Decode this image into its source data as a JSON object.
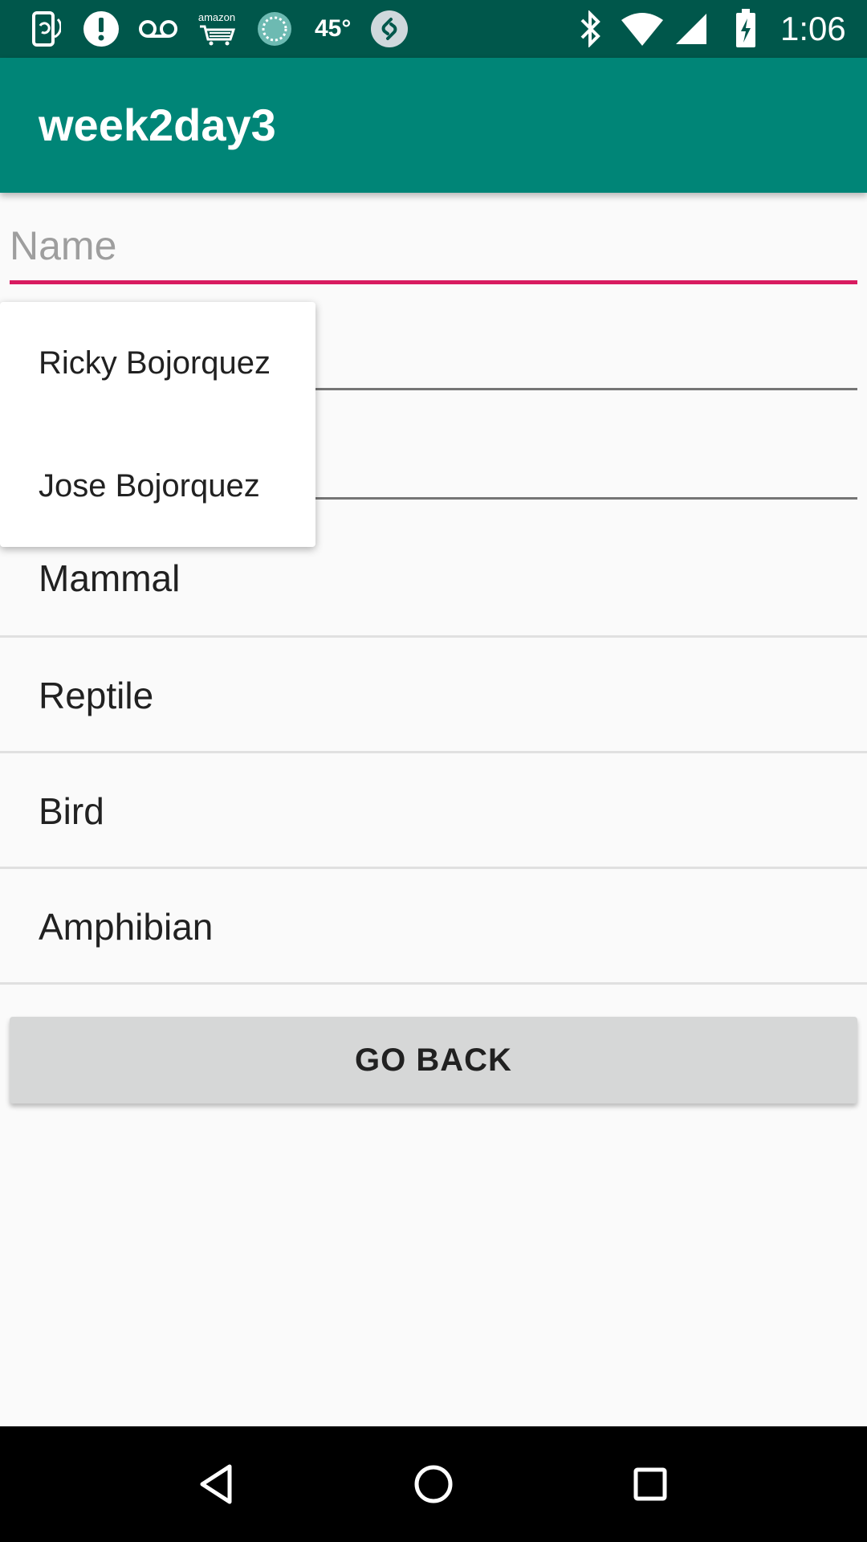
{
  "status_bar": {
    "temperature": "45°",
    "amazon_label": "amazon",
    "time": "1:06",
    "icons": [
      "screen-rotation-icon",
      "alert-icon",
      "voicemail-icon",
      "amazon-cart-icon",
      "weather-icon",
      "shazam-icon",
      "bluetooth-icon",
      "wifi-icon",
      "signal-icon",
      "battery-charging-icon"
    ]
  },
  "app_bar": {
    "title": "week2day3"
  },
  "form": {
    "name_placeholder": "Name",
    "name_value": ""
  },
  "dropdown": {
    "items": [
      "Ricky Bojorquez",
      "Jose Bojorquez"
    ]
  },
  "animal_list": {
    "items": [
      "Mammal",
      "Reptile",
      "Bird",
      "Amphibian"
    ]
  },
  "buttons": {
    "go_back": "GO BACK"
  },
  "nav_bar": {
    "icons": [
      "back-icon",
      "home-icon",
      "recents-icon"
    ]
  },
  "colors": {
    "status_bar": "#00574b",
    "app_bar": "#008577",
    "accent": "#d81b60",
    "button": "#d6d7d7"
  }
}
